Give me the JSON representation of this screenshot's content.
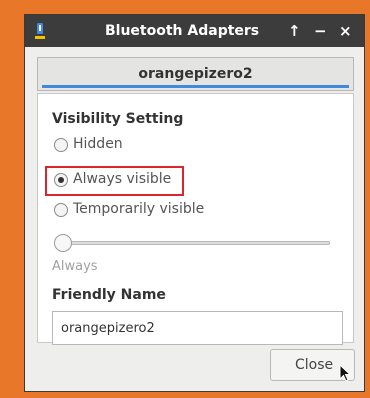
{
  "window": {
    "title": "Bluetooth Adapters",
    "controls": {
      "maximize": "↑",
      "minimize": "−",
      "close": "×"
    }
  },
  "tab": {
    "label": "orangepizero2"
  },
  "visibility": {
    "heading": "Visibility Setting",
    "options": [
      {
        "label": "Hidden",
        "selected": false
      },
      {
        "label": "Always visible",
        "selected": true
      },
      {
        "label": "Temporarily visible",
        "selected": false
      }
    ],
    "slider": {
      "label": "Always",
      "value": 0
    }
  },
  "friendly_name": {
    "heading": "Friendly Name",
    "value": "orangepizero2"
  },
  "footer": {
    "close_label": "Close"
  },
  "colors": {
    "background": "#e8772a",
    "titlebar": "#3c3c3c",
    "tab_accent": "#3f8ae0",
    "highlight": "#d9262a"
  },
  "icons": {
    "app": "bluetooth-app-icon",
    "cursor": "mouse-pointer-icon"
  }
}
